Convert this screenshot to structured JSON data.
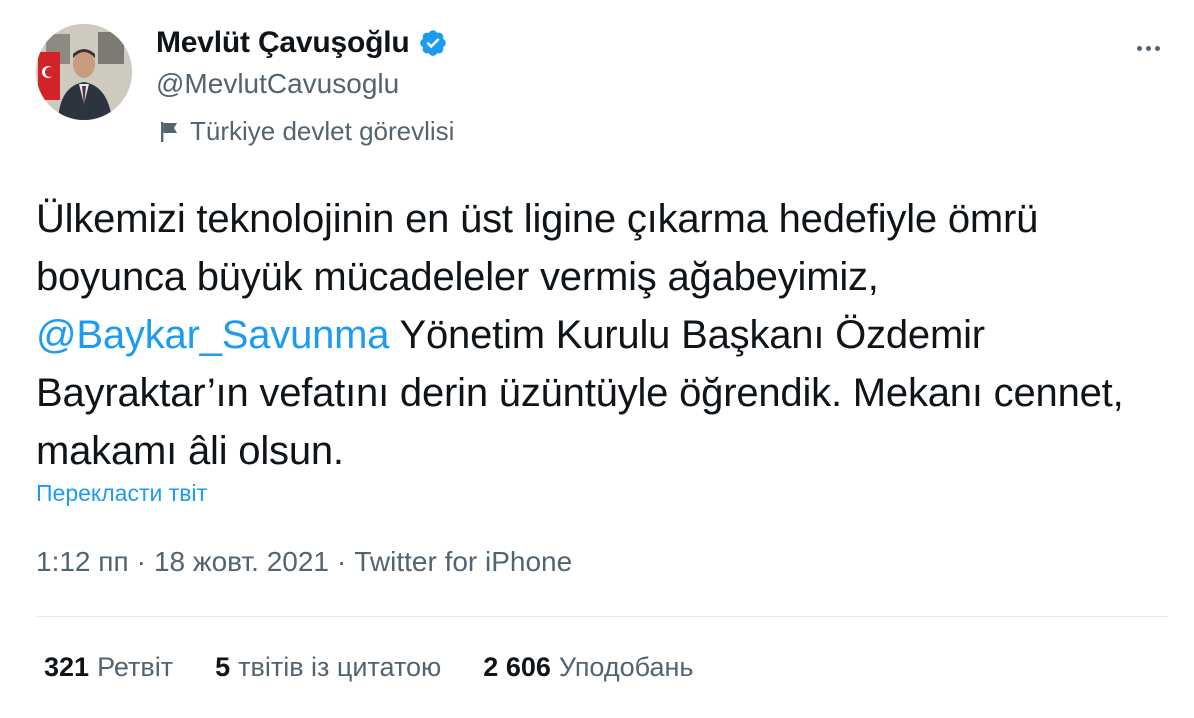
{
  "author": {
    "display_name": "Mevlüt Çavuşoğlu",
    "handle": "@MevlutCavusoglu",
    "label": "Türkiye devlet görevlisi",
    "avatar_icon": "profile-photo",
    "verified_icon": "verified-badge-icon",
    "label_icon": "flag-icon"
  },
  "tweet": {
    "text_before": "Ülkemizi teknolojinin en üst ligine çıkarma hedefiyle ömrü boyunca büyük mücadeleler vermiş ağabeyimiz, ",
    "mention": "@Baykar_Savunma",
    "text_after": " Yönetim Kurulu Başkanı Özdemir Bayraktar’ın vefatını derin üzüntüyle öğrendik. Mekanı cennet, makamı âli olsun.",
    "translate_label": "Перекласти твіт"
  },
  "meta": {
    "time": "1:12 пп",
    "date": "18 жовт. 2021",
    "source": "Twitter for iPhone",
    "separator": "·"
  },
  "stats": {
    "retweets_count": "321",
    "retweets_label": "Ретвіт",
    "quotes_count": "5",
    "quotes_label": "твітів із цитатою",
    "likes_count": "2 606",
    "likes_label": "Уподобань"
  },
  "colors": {
    "accent": "#1d9bf0",
    "text_primary": "#0f1419",
    "text_secondary": "#536471"
  }
}
